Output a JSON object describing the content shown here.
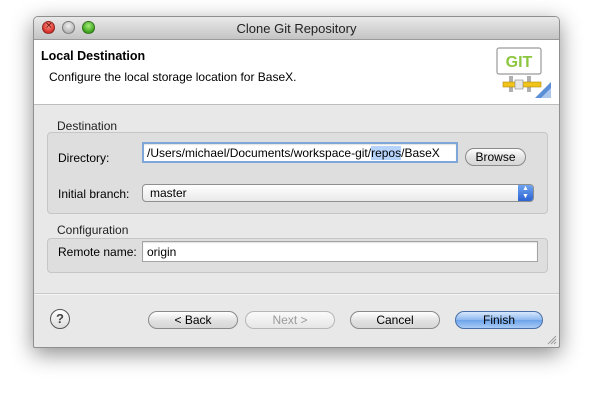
{
  "window": {
    "title": "Clone Git Repository",
    "close_glyph": "×"
  },
  "header": {
    "title": "Local Destination",
    "message": "Configure the local storage location for BaseX.",
    "badge_text": "GIT",
    "badge_icon": "git-wizard-banner-icon"
  },
  "destination": {
    "group_label": "Destination",
    "directory_label": "Directory:",
    "directory_value_pre": "/Users/michael/Documents/workspace-git/",
    "directory_value_sel": "repos",
    "directory_value_post": "/BaseX",
    "browse_label": "Browse",
    "branch_label": "Initial branch:",
    "branch_value": "master"
  },
  "configuration": {
    "group_label": "Configuration",
    "remote_label": "Remote name:",
    "remote_value": "origin"
  },
  "buttons": {
    "help_glyph": "?",
    "back": "< Back",
    "next": "Next >",
    "cancel": "Cancel",
    "finish": "Finish"
  },
  "colors": {
    "accent": "#6ca3ea",
    "selection": "#b5d3fb"
  }
}
